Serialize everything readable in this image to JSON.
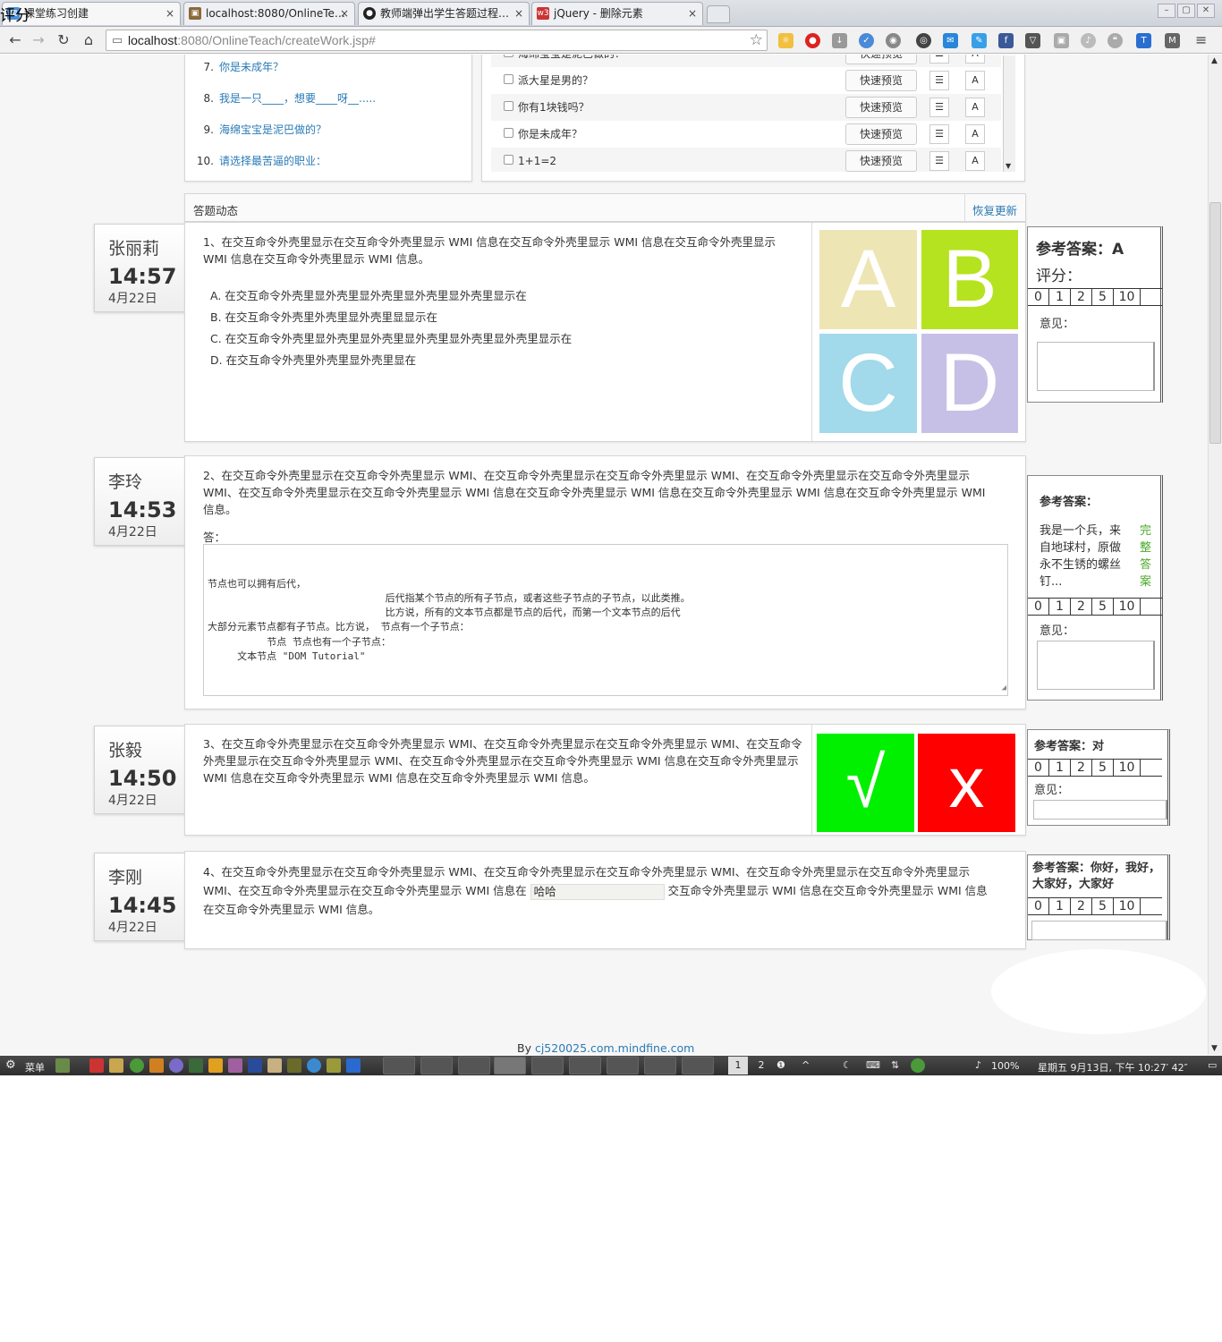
{
  "browser": {
    "overlay_label": "评分",
    "tabs": [
      {
        "title": "课堂练习创建",
        "close": "×"
      },
      {
        "title": "localhost:8080/OnlineTe…",
        "close": "×"
      },
      {
        "title": "教师端弹出学生答题过程…",
        "close": "×"
      },
      {
        "title": "jQuery - 删除元素",
        "close": "×"
      }
    ],
    "url_host": "localhost",
    "url_rest": ":8080/OnlineTeach/createWork.jsp#"
  },
  "question_list": [
    {
      "num": "7.",
      "text": "你是未成年？"
    },
    {
      "num": "8.",
      "text": "我是一只____，想要____呀__....."
    },
    {
      "num": "9.",
      "text": "海绵宝宝是泥巴做的？"
    },
    {
      "num": "10.",
      "text": "请选择最苦逼的职业："
    }
  ],
  "question_bank": {
    "preview_label": "快速预览",
    "rows": [
      "海绵宝宝是泥巴做的？",
      "派大星是男的？",
      "你有1块钱吗？",
      "你是未成年？",
      "1+1=2"
    ]
  },
  "dynamics": {
    "title": "答题动态",
    "restore": "恢复更新"
  },
  "scale": [
    "0",
    "1",
    "2",
    "5",
    "10"
  ],
  "answers": [
    {
      "name": "张丽莉",
      "time": "14:57",
      "date": "4月22日",
      "question": "1、在交互命令外壳里显示在交互命令外壳里显示 WMI 信息在交互命令外壳里显示 WMI 信息在交互命令外壳里显示 WMI 信息在交互命令外壳里显示 WMI 信息。",
      "options": [
        {
          "key": "A.",
          "text": "在交互命令外壳里显外壳里显外壳里显外壳里显外壳里显示在"
        },
        {
          "key": "B.",
          "text": "在交互命令外壳里外壳里显外壳里显显示在"
        },
        {
          "key": "C.",
          "text": "在交互命令外壳里显外壳里显外壳里显外壳里显外壳里显外壳里显示在"
        },
        {
          "key": "D.",
          "text": "在交互命令外壳里外壳里显外壳里显在"
        }
      ],
      "choices": [
        "A",
        "B",
        "C",
        "D"
      ],
      "ref_label": "参考答案：A",
      "score_label": "评分：",
      "note_label": "意见："
    },
    {
      "name": "李玲",
      "time": "14:53",
      "date": "4月22日",
      "question": "2、在交互命令外壳里显示在交互命令外壳里显示 WMI、在交互命令外壳里显示在交互命令外壳里显示 WMI、在交互命令外壳里显示在交互命令外壳里显示 WMI、在交互命令外壳里显示在交互命令外壳里显示 WMI 信息在交互命令外壳里显示 WMI 信息在交互命令外壳里显示 WMI 信息在交互命令外壳里显示 WMI 信息。",
      "answer_label": "答：",
      "answer_lines": [
        "节点也可以拥有后代，",
        "                              后代指某个节点的所有子节点，或者这些子节点的子节点，以此类推。",
        "                              比方说，所有的文本节点都是节点的后代，而第一个文本节点的后代",
        "大部分元素节点都有子节点。比方说， 节点有一个子节点：",
        "          节点 节点也有一个子节点：",
        "     文本节点 \"DOM Tutorial\""
      ],
      "ref_label": "参考答案：",
      "ref_text": "我是一个兵，来自地球村，原做永不生锈的螺丝钉...",
      "full_link": "完整答案",
      "note_label": "意见："
    },
    {
      "name": "张毅",
      "time": "14:50",
      "date": "4月22日",
      "question": "3、在交互命令外壳里显示在交互命令外壳里显示 WMI、在交互命令外壳里显示在交互命令外壳里显示 WMI、在交互命令外壳里显示在交互命令外壳里显示 WMI、在交互命令外壳里显示在交互命令外壳里显示 WMI 信息在交互命令外壳里显示 WMI 信息在交互命令外壳里显示 WMI 信息在交互命令外壳里显示 WMI 信息。",
      "right": "√",
      "wrong": "x",
      "ref_label": "参考答案：对",
      "note_label": "意见："
    },
    {
      "name": "李刚",
      "time": "14:45",
      "date": "4月22日",
      "question_a": "4、在交互命令外壳里显示在交互命令外壳里显示 WMI、在交互命令外壳里显示在交互命令外壳里显示 WMI、在交互命令外壳里显示在交互命令外壳里显示 WMI、在交互命令外壳里显示在交互命令外壳里显示 WMI 信息在",
      "fill_value": "哈哈",
      "question_b": "交互命令外壳里显示 WMI 信息在交互命令外壳里显示 WMI 信息在交互命令外壳里显示 WMI 信息。",
      "ref_label": "参考答案：你好，我好，大家好，大家好"
    }
  ],
  "footer": {
    "by": "By ",
    "link": "cj520025.com.mindfine.com"
  },
  "taskbar": {
    "menu": "菜单",
    "ws1": "1",
    "ws2": "2",
    "battery": "100%",
    "clock": "星期五 9月13日, 下午 10:27′ 42″"
  },
  "colors": {
    "A": "#eee5b5",
    "B": "#b5e31f",
    "C": "#a2d9eb",
    "D": "#c7c0e6",
    "right": "#00f000",
    "wrong": "#ff0000",
    "link": "#2a7ab5"
  }
}
